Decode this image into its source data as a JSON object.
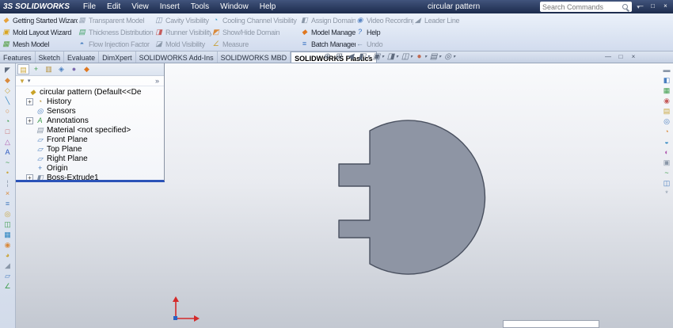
{
  "titlebar": {
    "logo_mark": "3S",
    "app_name": "SOLIDWORKS",
    "menus": [
      {
        "name": "menu-file",
        "label": "File"
      },
      {
        "name": "menu-edit",
        "label": "Edit"
      },
      {
        "name": "menu-view",
        "label": "View"
      },
      {
        "name": "menu-insert",
        "label": "Insert"
      },
      {
        "name": "menu-tools",
        "label": "Tools"
      },
      {
        "name": "menu-window",
        "label": "Window"
      },
      {
        "name": "menu-help",
        "label": "Help"
      }
    ],
    "document_title": "circular pattern",
    "search": {
      "placeholder": "Search Commands",
      "caret": "▾"
    },
    "window_buttons": [
      {
        "name": "minimize-button",
        "glyph": "—"
      },
      {
        "name": "restore-button",
        "glyph": "□"
      },
      {
        "name": "close-button",
        "glyph": "×"
      }
    ]
  },
  "ribbon": {
    "row1": [
      {
        "name": "getting-started-wizard-button",
        "label": "Getting Started Wizard",
        "glyph": "◆",
        "color": "#e6a23c",
        "state": "enabled"
      },
      {
        "name": "transparent-model-button",
        "label": "Transparent Model",
        "glyph": "▦",
        "color": "#9aa7b8",
        "state": "disabled"
      },
      {
        "name": "cavity-visibility-button",
        "label": "Cavity Visibility",
        "glyph": "◫",
        "color": "#7f8ea3",
        "state": "disabled"
      },
      {
        "name": "cooling-channel-visibility-button",
        "label": "Cooling Channel Visibility",
        "glyph": "◔",
        "color": "#4aa3c8",
        "state": "disabled"
      },
      {
        "name": "assign-domain-button",
        "label": "Assign Domain",
        "glyph": "◧",
        "color": "#8a97a8",
        "state": "disabled"
      },
      {
        "name": "video-recording-button",
        "label": "Video Recording",
        "glyph": "◉",
        "color": "#5b87c5",
        "state": "disabled"
      },
      {
        "name": "leader-line-button",
        "label": "Leader Line",
        "glyph": "◢",
        "color": "#8a97a8",
        "state": "disabled"
      }
    ],
    "row2": [
      {
        "name": "mold-layout-wizard-button",
        "label": "Mold Layout Wizard",
        "glyph": "▣",
        "color": "#d9a520",
        "state": "enabled"
      },
      {
        "name": "thickness-distribution-button",
        "label": "Thickness Distribution",
        "glyph": "▤",
        "color": "#47a36b",
        "state": "disabled"
      },
      {
        "name": "runner-visibility-button",
        "label": "Runner Visibility",
        "glyph": "◨",
        "color": "#c55b5b",
        "state": "disabled"
      },
      {
        "name": "show-hide-domain-button",
        "label": "Show/Hide Domain",
        "glyph": "◩",
        "color": "#d98a3c",
        "state": "disabled"
      },
      {
        "name": "model-manager-button",
        "label": "Model Manager",
        "glyph": "◆",
        "color": "#e07820",
        "state": "enabled"
      },
      {
        "name": "help-button",
        "label": "Help",
        "glyph": "?",
        "color": "#3b74c4",
        "state": "enabled"
      }
    ],
    "row3": [
      {
        "name": "mesh-model-button",
        "label": "Mesh Model",
        "glyph": "▦",
        "color": "#56a046",
        "state": "enabled"
      },
      {
        "name": "flow-injection-factor-button",
        "label": "Flow Injection Factor",
        "glyph": "◓",
        "color": "#4a7fc0",
        "state": "disabled"
      },
      {
        "name": "mold-visibility-button",
        "label": "Mold Visibility",
        "glyph": "◪",
        "color": "#8a97a8",
        "state": "disabled"
      },
      {
        "name": "measure-button",
        "label": "Measure",
        "glyph": "∠",
        "color": "#c7a23c",
        "state": "disabled"
      },
      {
        "name": "batch-manager-button",
        "label": "Batch Manager",
        "glyph": "≡",
        "color": "#3b74c4",
        "state": "enabled"
      },
      {
        "name": "undo-button",
        "label": "Undo",
        "glyph": "←",
        "color": "#6f86a0",
        "state": "disabled"
      }
    ]
  },
  "tabbar": {
    "tabs": [
      {
        "name": "tab-features",
        "label": "Features",
        "state": ""
      },
      {
        "name": "tab-sketch",
        "label": "Sketch",
        "state": ""
      },
      {
        "name": "tab-evaluate",
        "label": "Evaluate",
        "state": ""
      },
      {
        "name": "tab-dimxpert",
        "label": "DimXpert",
        "state": ""
      },
      {
        "name": "tab-solidworks-add-ins",
        "label": "SOLIDWORKS Add-Ins",
        "state": ""
      },
      {
        "name": "tab-solidworks-mbd",
        "label": "SOLIDWORKS MBD",
        "state": ""
      },
      {
        "name": "tab-solidworks-plastics",
        "label": "SOLIDWORKS Plastics",
        "state": "active"
      }
    ],
    "hud": [
      {
        "name": "zoom-to-fit-icon",
        "glyph": "⊕",
        "caret": "",
        "color": "#5f6b7e"
      },
      {
        "name": "zoom-to-area-icon",
        "glyph": "⊞",
        "caret": "",
        "color": "#5f6b7e"
      },
      {
        "name": "previous-view-icon",
        "glyph": "◀",
        "caret": "",
        "color": "#5f6b7e"
      },
      {
        "name": "section-view-icon",
        "glyph": "◧",
        "caret": "▾",
        "color": "#5f6b7e"
      },
      {
        "name": "view-orientation-icon",
        "glyph": "▣",
        "caret": "▾",
        "color": "#5f6b7e"
      },
      {
        "name": "display-style-icon",
        "glyph": "◨",
        "caret": "▾",
        "color": "#5f6b7e"
      },
      {
        "name": "hide-show-items-icon",
        "glyph": "◫",
        "caret": "▾",
        "color": "#5f6b7e"
      },
      {
        "name": "edit-appearance-icon",
        "glyph": "●",
        "caret": "▾",
        "color": "#c06a52"
      },
      {
        "name": "apply-scene-icon",
        "glyph": "▤",
        "caret": "▾",
        "color": "#5f6b7e"
      },
      {
        "name": "view-settings-icon",
        "glyph": "◎",
        "caret": "▾",
        "color": "#5f6b7e"
      }
    ],
    "window_buttons": [
      {
        "name": "doc-minimize-button",
        "glyph": "—"
      },
      {
        "name": "doc-restore-button",
        "glyph": "□"
      },
      {
        "name": "doc-close-button",
        "glyph": "×"
      }
    ]
  },
  "panel": {
    "tabs": [
      {
        "name": "featuremanager-tab",
        "glyph": "▤",
        "color": "#c9a53c",
        "state": "active"
      },
      {
        "name": "propertymanager-tab",
        "glyph": "+",
        "color": "#3f9e4e",
        "state": ""
      },
      {
        "name": "configurationmanager-tab",
        "glyph": "▥",
        "color": "#b58f3a",
        "state": ""
      },
      {
        "name": "dimxpertmanager-tab",
        "glyph": "◈",
        "color": "#4a7fc0",
        "state": ""
      },
      {
        "name": "displaymanager-tab",
        "glyph": "●",
        "color": "#7b68ae",
        "state": ""
      },
      {
        "name": "plasticsmanager-tab",
        "glyph": "◆",
        "color": "#e07820",
        "state": ""
      }
    ],
    "chevron": "»",
    "filter": {
      "funnel_glyph": "▼",
      "caret": "▾"
    }
  },
  "tree": {
    "items": [
      {
        "name": "tree-item-part-root",
        "label": "circular pattern (Default<<De",
        "expander": "",
        "glyph": "◆",
        "color": "#c9a227",
        "indent": "ind0"
      },
      {
        "name": "tree-item-history",
        "label": "History",
        "expander": "+",
        "glyph": "◔",
        "color": "#b58f3a",
        "indent": "ind1"
      },
      {
        "name": "tree-item-sensors",
        "label": "Sensors",
        "expander": "",
        "glyph": "◎",
        "color": "#4a7fc0",
        "indent": "ind1"
      },
      {
        "name": "tree-item-annotations",
        "label": "Annotations",
        "expander": "+",
        "glyph": "A",
        "color": "#3f9e4e",
        "indent": "ind1"
      },
      {
        "name": "tree-item-material",
        "label": "Material <not specified>",
        "expander": "",
        "glyph": "▤",
        "color": "#8a97a8",
        "indent": "ind1"
      },
      {
        "name": "tree-item-front-plane",
        "label": "Front Plane",
        "expander": "",
        "glyph": "▱",
        "color": "#4a7fc0",
        "indent": "ind1"
      },
      {
        "name": "tree-item-top-plane",
        "label": "Top Plane",
        "expander": "",
        "glyph": "▱",
        "color": "#4a7fc0",
        "indent": "ind1"
      },
      {
        "name": "tree-item-right-plane",
        "label": "Right Plane",
        "expander": "",
        "glyph": "▱",
        "color": "#4a7fc0",
        "indent": "ind1"
      },
      {
        "name": "tree-item-origin",
        "label": "Origin",
        "expander": "",
        "glyph": "+",
        "color": "#4a7fc0",
        "indent": "ind1"
      },
      {
        "name": "tree-item-boss-extrude1",
        "label": "Boss-Extrude1",
        "expander": "+",
        "glyph": "◧",
        "color": "#7a8aa0",
        "indent": "ind1"
      }
    ]
  },
  "left_toolbar": {
    "icons": [
      {
        "name": "select-icon",
        "glyph": "◤",
        "color": "#5f6b7e"
      },
      {
        "name": "sketch-icon",
        "glyph": "◆",
        "color": "#d98a3c"
      },
      {
        "name": "smart-dimension-icon",
        "glyph": "◇",
        "color": "#c9a53c"
      },
      {
        "name": "line-icon",
        "glyph": "╲",
        "color": "#2e86c1"
      },
      {
        "name": "circle-icon",
        "glyph": "○",
        "color": "#d98a3c"
      },
      {
        "name": "arc-icon",
        "glyph": "◔",
        "color": "#3f9e4e"
      },
      {
        "name": "rectangle-icon",
        "glyph": "□",
        "color": "#c55b5b"
      },
      {
        "name": "polygon-icon",
        "glyph": "△",
        "color": "#b05bb0"
      },
      {
        "name": "text-icon",
        "glyph": "A",
        "color": "#2e5bc0"
      },
      {
        "name": "spline-icon",
        "glyph": "~",
        "color": "#3f9e4e"
      },
      {
        "name": "point-icon",
        "glyph": "•",
        "color": "#c9a53c"
      },
      {
        "name": "centerline-icon",
        "glyph": "¦",
        "color": "#8a97a8"
      },
      {
        "name": "trim-entities-icon",
        "glyph": "×",
        "color": "#d98a3c"
      },
      {
        "name": "convert-entities-icon",
        "glyph": "≡",
        "color": "#4a7fc0"
      },
      {
        "name": "offset-entities-icon",
        "glyph": "◎",
        "color": "#c9a53c"
      },
      {
        "name": "mirror-entities-icon",
        "glyph": "◫",
        "color": "#3f9e4e"
      },
      {
        "name": "linear-pattern-icon",
        "glyph": "▦",
        "color": "#2e86c1"
      },
      {
        "name": "circular-pattern-icon",
        "glyph": "◉",
        "color": "#d98a3c"
      },
      {
        "name": "fillet-icon",
        "glyph": "◕",
        "color": "#c9a53c"
      },
      {
        "name": "chamfer-icon",
        "glyph": "◢",
        "color": "#8a97a8"
      },
      {
        "name": "reference-plane-icon",
        "glyph": "▱",
        "color": "#4a7fc0"
      },
      {
        "name": "measure-tool-icon",
        "glyph": "∠",
        "color": "#3f9e4e"
      }
    ]
  },
  "right_toolbar": {
    "icons": [
      {
        "name": "rollback-icon",
        "glyph": "▬",
        "color": "#8a97a8"
      },
      {
        "name": "boundary-conditions-icon",
        "glyph": "◧",
        "color": "#4a7fc0"
      },
      {
        "name": "mesh-icon",
        "glyph": "▦",
        "color": "#3f9e4e"
      },
      {
        "name": "injection-location-icon",
        "glyph": "◉",
        "color": "#c55b5b"
      },
      {
        "name": "material-icon",
        "glyph": "▤",
        "color": "#c9a53c"
      },
      {
        "name": "process-parameters-icon",
        "glyph": "◎",
        "color": "#4a7fc0"
      },
      {
        "name": "flow-results-icon",
        "glyph": "◔",
        "color": "#d98a3c"
      },
      {
        "name": "cool-results-icon",
        "glyph": "◒",
        "color": "#2e86c1"
      },
      {
        "name": "warp-results-icon",
        "glyph": "◐",
        "color": "#b05bb0"
      },
      {
        "name": "report-icon",
        "glyph": "▣",
        "color": "#8a97a8"
      },
      {
        "name": "xy-plot-icon",
        "glyph": "~",
        "color": "#3f9e4e"
      },
      {
        "name": "clipping-plane-icon",
        "glyph": "◫",
        "color": "#4a7fc0"
      },
      {
        "name": "plastics-settings-icon",
        "glyph": "*",
        "color": "#8a97a8"
      }
    ]
  },
  "viewport": {
    "part_fill": "#8e95a4",
    "part_stroke": "#4a5160",
    "triad_color": "#d42a2a",
    "triad_z_color": "#2a62c4"
  }
}
